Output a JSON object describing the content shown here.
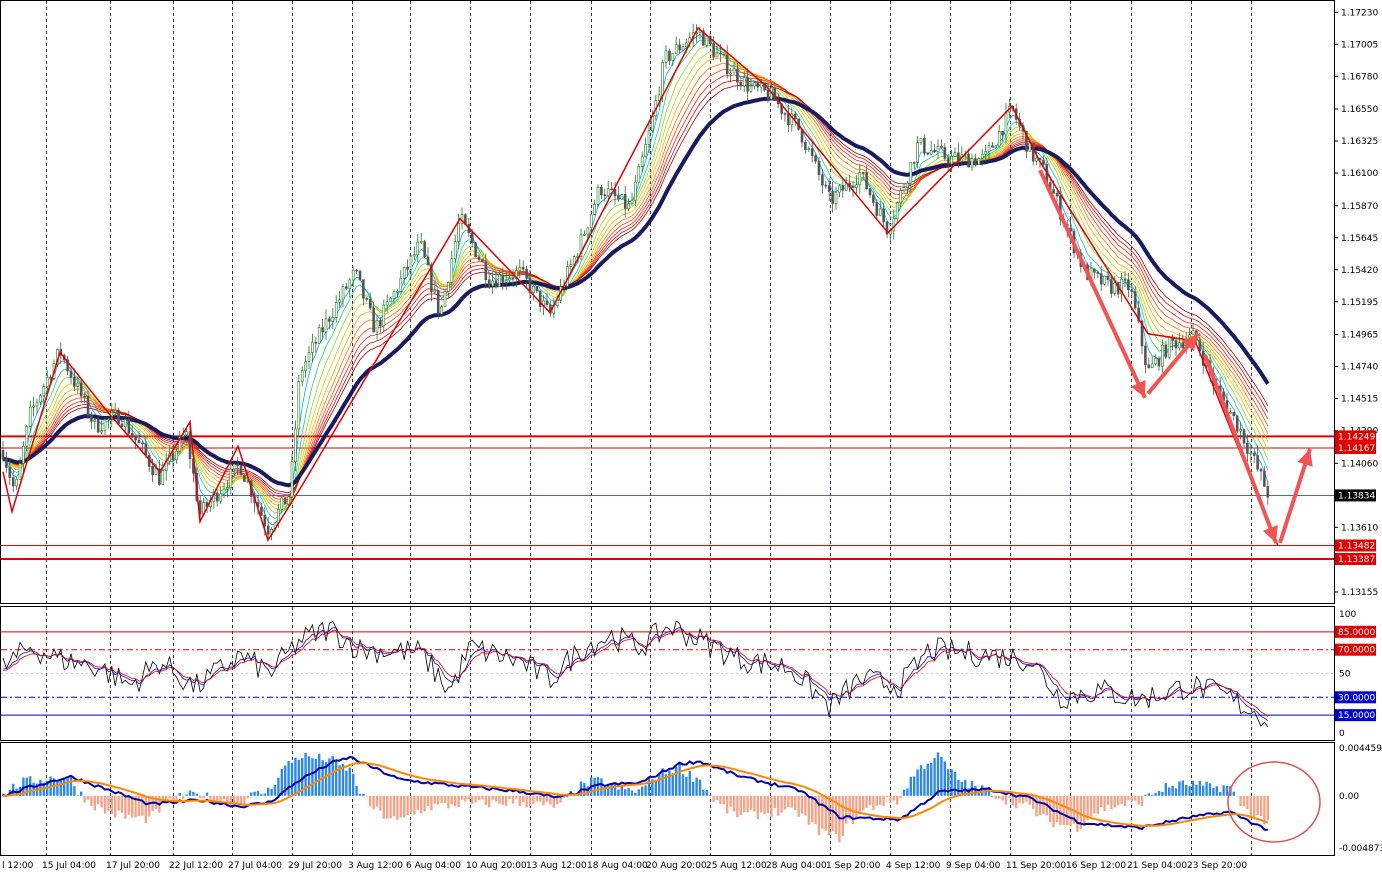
{
  "price_axis": {
    "ticks": [
      "1.17230",
      "1.17005",
      "1.16780",
      "1.16550",
      "1.16325",
      "1.16100",
      "1.15870",
      "1.15645",
      "1.15420",
      "1.15195",
      "1.14965",
      "1.14740",
      "1.14515",
      "1.14290",
      "1.14060",
      "1.13610",
      "1.13155"
    ],
    "tick_values": [
      1.1723,
      1.17005,
      1.1678,
      1.1655,
      1.16325,
      1.161,
      1.1587,
      1.15645,
      1.1542,
      1.15195,
      1.14965,
      1.1474,
      1.14515,
      1.1429,
      1.1406,
      1.1361,
      1.13155
    ],
    "range": [
      1.1312,
      1.1726
    ]
  },
  "levels": [
    {
      "label": "1.14249",
      "value": 1.14249,
      "color": "#e00000",
      "style": "thick"
    },
    {
      "label": "1.14167",
      "value": 1.14167,
      "color": "#e00000",
      "style": "thin"
    },
    {
      "label": "1.13834",
      "value": 1.13834,
      "color": "#000000",
      "style": "current"
    },
    {
      "label": "1.13482",
      "value": 1.13482,
      "color": "#e00000",
      "style": "thin"
    },
    {
      "label": "1.13387",
      "value": 1.13387,
      "color": "#e00000",
      "style": "thick"
    }
  ],
  "time_labels": [
    "l 12:00",
    "15 Jul 04:00",
    "17 Jul 20:00",
    "22 Jul 12:00",
    "27 Jul 04:00",
    "29 Jul 20:00",
    "3 Aug 12:00",
    "6 Aug 04:00",
    "10 Aug 20:00",
    "13 Aug 12:00",
    "18 Aug 04:00",
    "20 Aug 20:00",
    "25 Aug 12:00",
    "28 Aug 04:00",
    "1 Sep 20:00",
    "4 Sep 12:00",
    "9 Sep 04:00",
    "11 Sep 20:00",
    "16 Sep 12:00",
    "21 Sep 04:00",
    "23 Sep 20:00"
  ],
  "osc_axis": {
    "ticks": [
      "100",
      "50",
      "0"
    ],
    "levels": [
      {
        "label": "85.0000",
        "value": 85,
        "color": "#e00000"
      },
      {
        "label": "70.0000",
        "value": 70,
        "color": "#e00000"
      },
      {
        "label": "30.0000",
        "value": 30,
        "color": "#0000cc"
      },
      {
        "label": "15.0000",
        "value": 15,
        "color": "#0000cc"
      }
    ]
  },
  "macd_axis": {
    "ticks": [
      "0.0044593",
      "0.00",
      "-0.004873"
    ]
  },
  "colors": {
    "bull_candle": "#1e7a1e",
    "bear_candle": "#555555",
    "zigzag": "#e00000",
    "ribbon_main": "#1a1a5e",
    "arrows": "#f25454",
    "macd_pos": "#2f89e8",
    "macd_neg": "#f6a488",
    "macd_line": "#0000aa",
    "signal_line": "#ff8800"
  },
  "chart_data": {
    "type": "line",
    "title": "",
    "series": [
      {
        "name": "",
        "x": [
          "l 12:00",
          "15 Jul 04:00",
          "17 Jul 20:00",
          "22 Jul 12:00",
          "27 Jul 04:00",
          "29 Jul 20:00",
          "3 Aug 12:00",
          "6 Aug 04:00",
          "10 Aug 20:00",
          "13 Aug 12:00",
          "18 Aug 04:00",
          "20 Aug 20:00",
          "25 Aug 12:00",
          "28 Aug 04:00",
          "1 Sep 20:00",
          "4 Sep 12:00",
          "9 Sep 04:00",
          "11 Sep 20:00",
          "16 Sep 12:00",
          "21 Sep 04:00",
          "23 Sep 20:00"
        ],
        "y": [
          1.1415,
          1.143,
          1.1425,
          1.141,
          1.139,
          1.14,
          1.15,
          1.154,
          1.1535,
          1.1545,
          1.164,
          1.17,
          1.166,
          1.1595,
          1.1605,
          1.162,
          1.163,
          1.156,
          1.148,
          1.145,
          1.1383
        ]
      }
    ],
    "ylim": [
      1.1312,
      1.1726
    ]
  }
}
